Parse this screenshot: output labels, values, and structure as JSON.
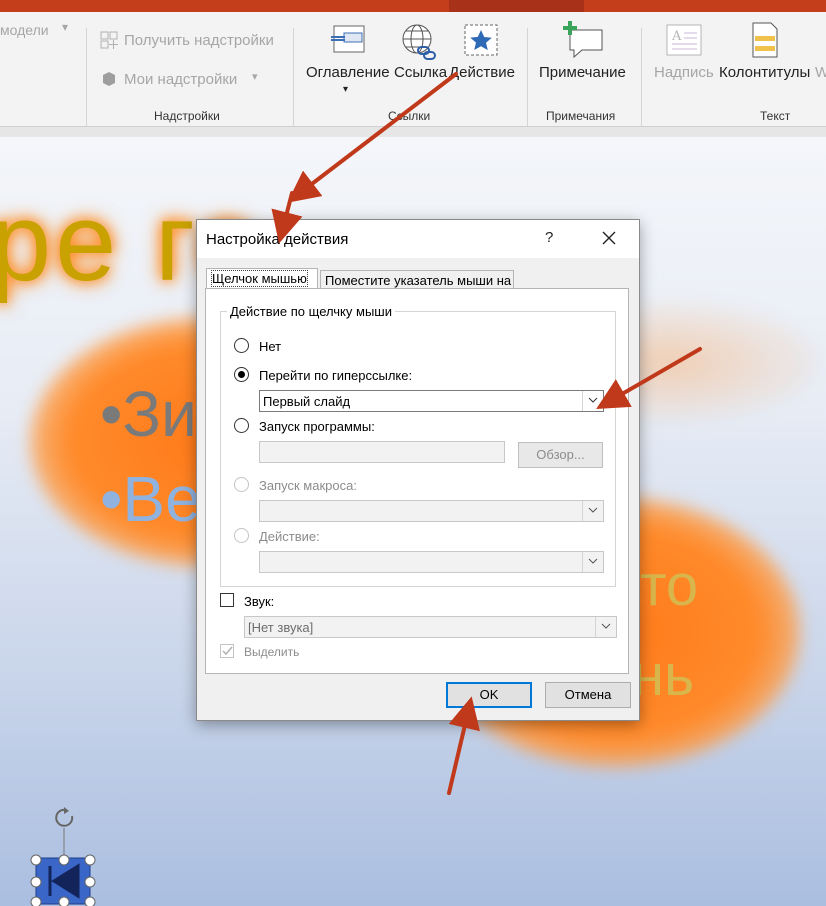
{
  "ribbon": {
    "partial_left_label": "модели",
    "get_addins": "Получить надстройки",
    "my_addins": "Мои надстройки",
    "group_addins": "Надстройки",
    "toc": "Оглавление",
    "link": "Ссылка",
    "action": "Действие",
    "group_links": "Ссылки",
    "comment": "Примечание",
    "group_comments": "Примечания",
    "textbox": "Надпись",
    "header_footer": "Колонтитулы",
    "partial_right": "W",
    "group_text": "Текст"
  },
  "slide": {
    "title_fragment": "ре     го",
    "bullet1": "•Зи",
    "bullet2": "•Ве",
    "text_right1": "то",
    "text_right2": "нь"
  },
  "dialog": {
    "title": "Настройка действия",
    "help": "?",
    "tabs": [
      {
        "label": "Щелчок мышью",
        "active": true
      },
      {
        "label": "Поместите указатель мыши на",
        "active": false
      }
    ],
    "group_label": "Действие по щелчку мыши",
    "options": {
      "none": "Нет",
      "hyperlink": "Перейти по гиперссылке:",
      "hyperlink_value": "Первый слайд",
      "run_program": "Запуск программы:",
      "browse": "Обзор...",
      "run_macro": "Запуск макроса:",
      "action": "Действие:"
    },
    "sound_label": "Звук:",
    "sound_value": "[Нет звука]",
    "highlight_label": "Выделить",
    "ok": "OK",
    "cancel": "Отмена"
  },
  "colors": {
    "ribbon_accent": "#c43e1c",
    "arrow": "#c0391b",
    "default_button_border": "#0078d7",
    "slide_title": "#c9a100"
  }
}
